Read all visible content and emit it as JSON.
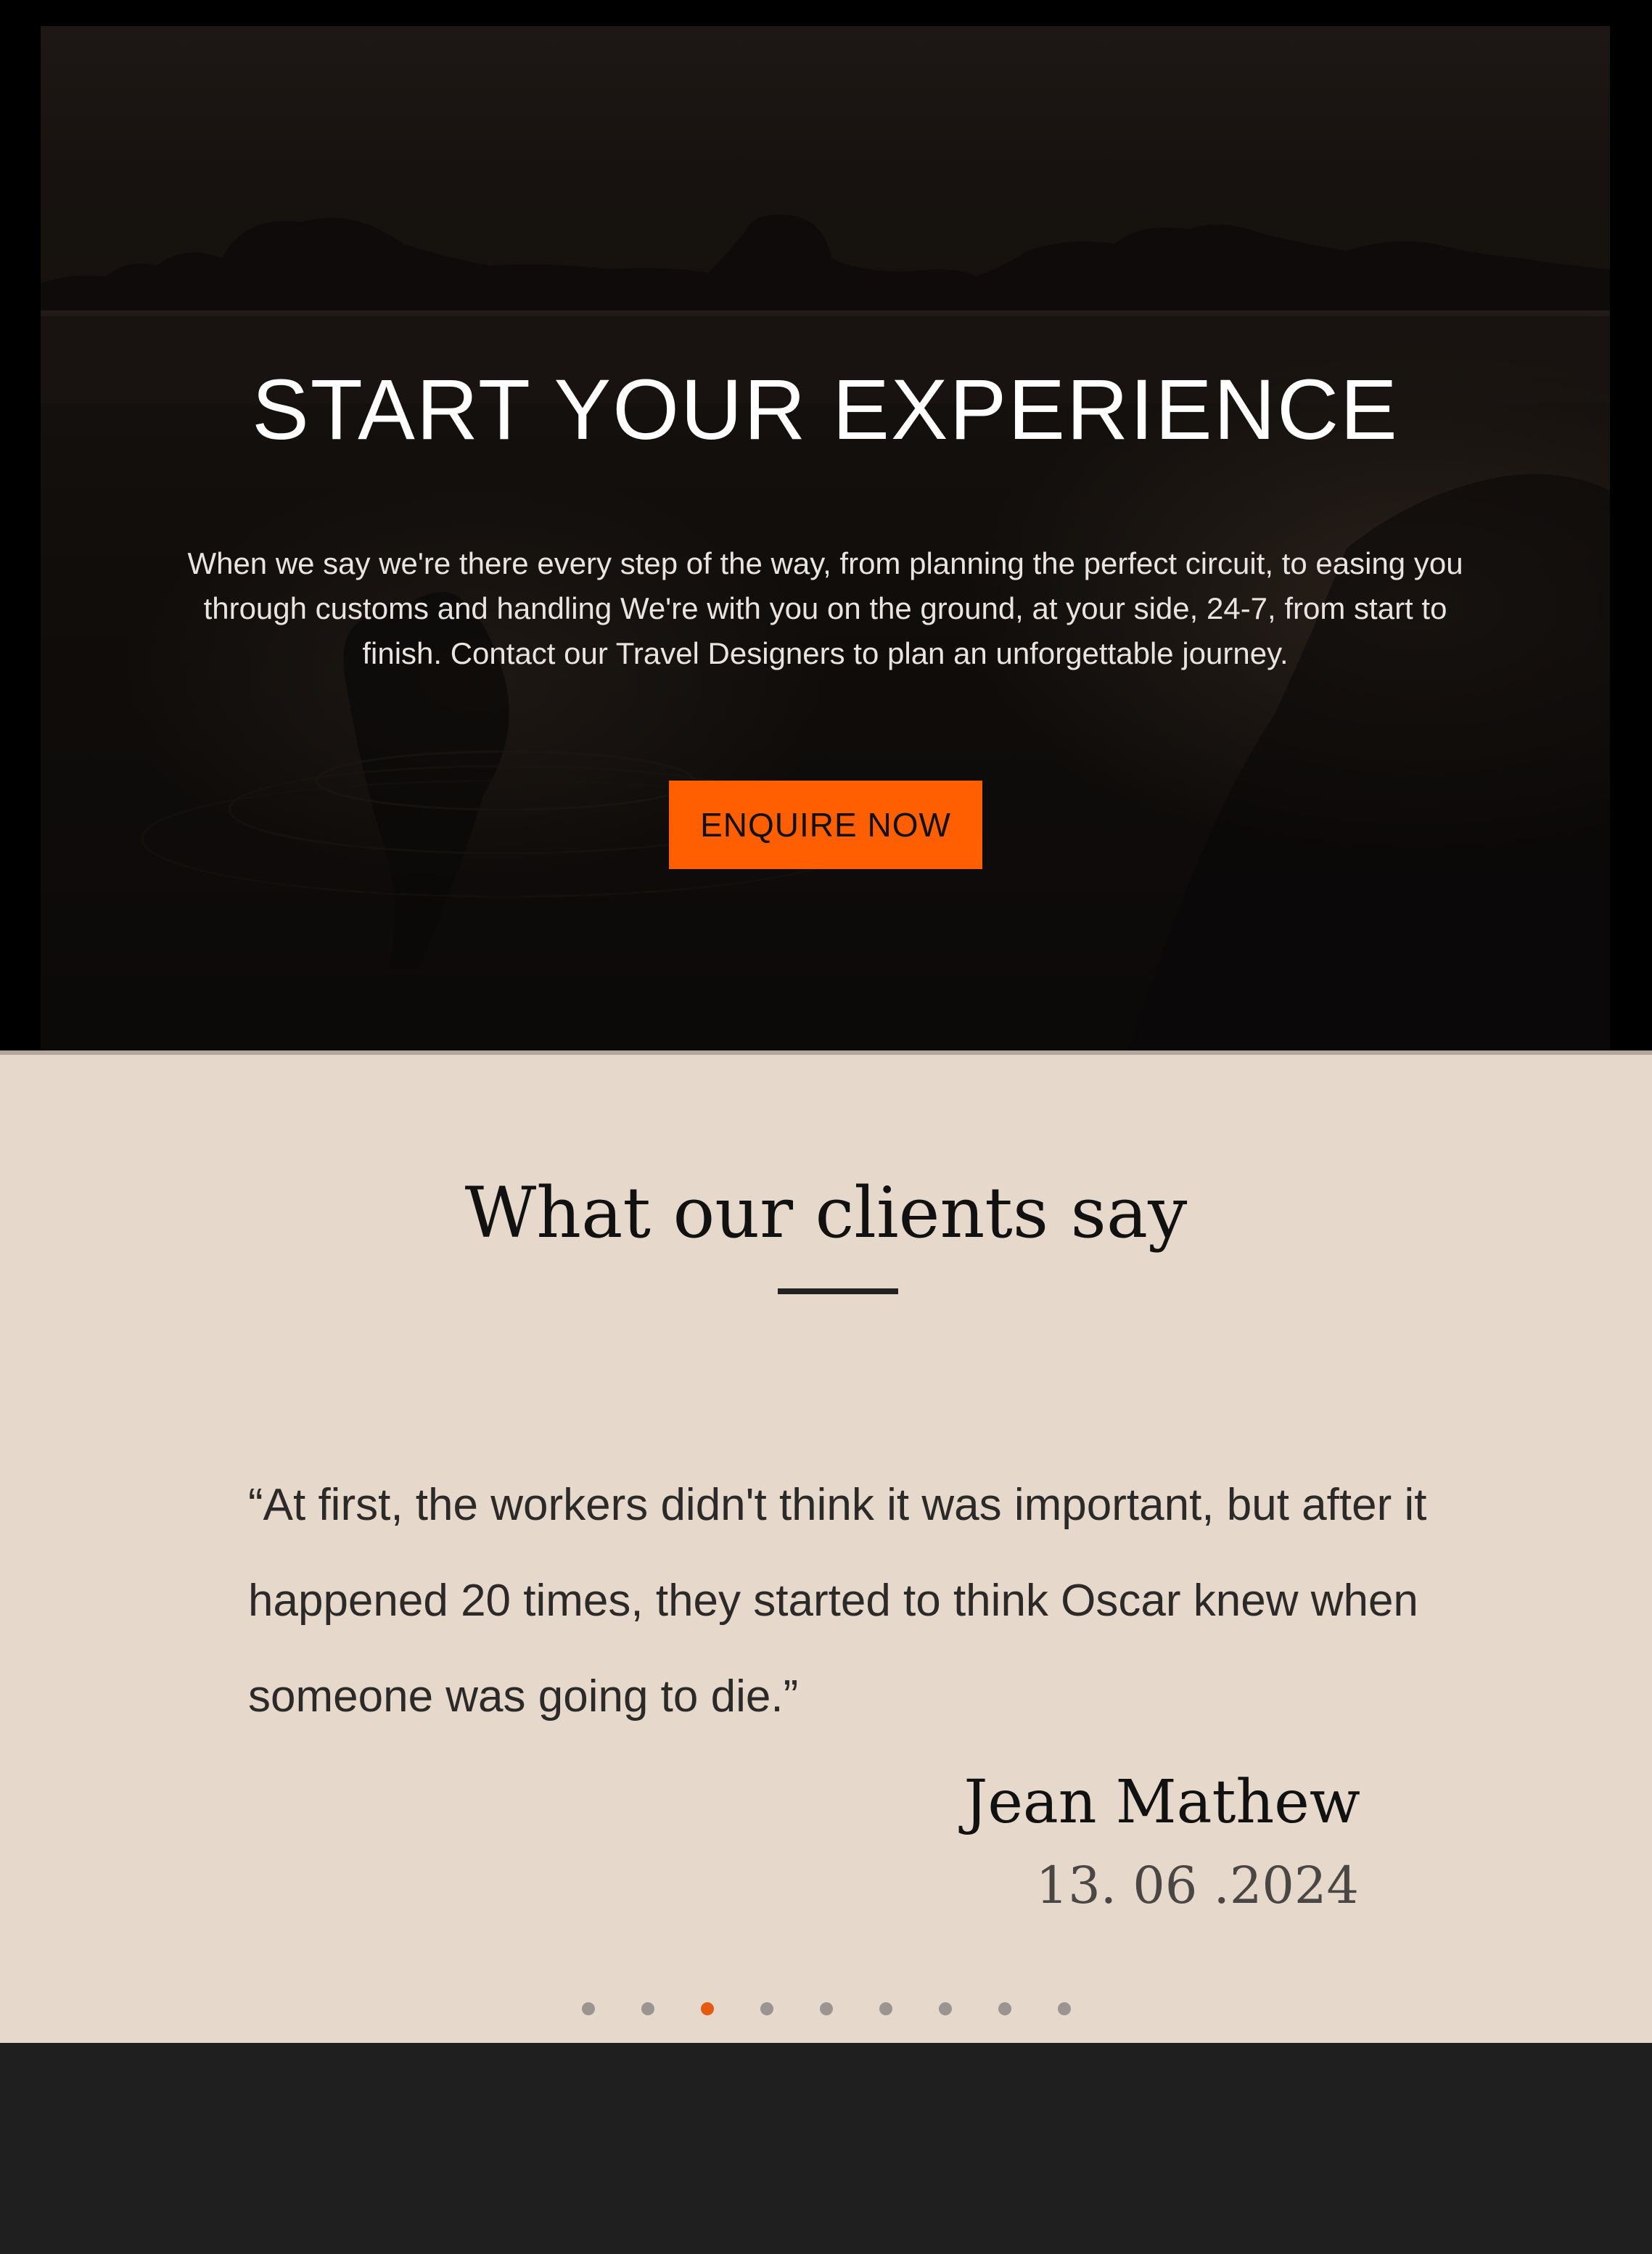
{
  "hero": {
    "title": "START YOUR EXPERIENCE",
    "text": "When we say we're there every step of the way, from planning the perfect circuit, to easing you through customs and handling We're with you on the ground, at your side, 24-7, from start to finish. Contact our Travel Designers to plan an unforgettable journey.",
    "cta_label": "ENQUIRE NOW",
    "cta_color": "#ff5f00"
  },
  "testimonials": {
    "title": "What our clients say",
    "quote": "“At first, the workers didn't think it was important, but after it happened 20 times, they started to think Oscar knew when someone was going to die.”",
    "author": "Jean Mathew",
    "date": "13. 06 .2024",
    "slide_count": 9,
    "active_slide": 3,
    "active_dot_color": "#e55a12",
    "background_color": "#e6d9cc"
  }
}
